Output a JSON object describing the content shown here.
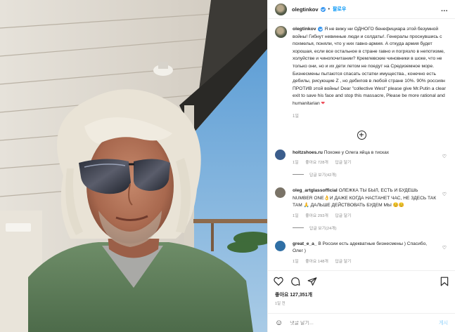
{
  "header": {
    "username": "olegtinkov",
    "separator": "•",
    "follow_label": "팔로우",
    "more_label": "..."
  },
  "caption": {
    "username": "olegtinkov",
    "text": "Я не вижу ни ОДНОГО бенефициара этой безумной войны! Гибнут невинные люди и солдаты!. Генералы проснувшись с похмелья, поняли, что у них гавно-армия. А откуда армия будет хорошая, если все остальное в стране гавно и погрязло в непотизме, холуйстве и чинопочитании? Кремлевские чиновники в шоке, что не только они, но и их дети летом не поедут на Средиземное море. Бизнесмены пытаются спасать остатки имущества., конечно есть дебилы, рисующие Z , но дебилов в любой стране 10%. 90% россиян ПРОТИВ этой войны! Dear \"collective West\" please give Mr.Putin a clear exit to save his face and stop this massacre, Please be more rational and humanitarian",
    "heart": "❤",
    "date": "1일"
  },
  "comments": [
    {
      "username": "holtzshoes.ru",
      "text": "Похоже у Олега яйца в тисках",
      "time": "1일",
      "likes": "좋아요 728개",
      "reply": "답글 달기",
      "replies": "답글 보기(42개)",
      "avatar_color": "#3b5d8c"
    },
    {
      "username": "oleg_artglassofficial",
      "text": "ОЛЕЖКА ТЫ БЫЛ, ЕСТЬ И БУДЕШЬ NUMBER ONE👌И ДАЖЕ КОГДА НАСТАНЕТ ЧАС, НЕ ЗДЕСЬ ТАК ТАМ 🙏 ДАЛЬШЕ ДЕЙСТВОВАТЬ БУДЕМ МЫ 😊😊",
      "time": "1일",
      "likes": "좋아요 293개",
      "reply": "답글 달기",
      "replies": "답글 보기(24개)",
      "avatar_color": "#7a7367"
    },
    {
      "username": "great_e_a_",
      "text": "В России есть адекватные бизнесмены ) Спасибо, Олег )",
      "time": "1일",
      "likes": "좋아요 148개",
      "reply": "답글 달기",
      "replies": "",
      "avatar_color": "#2f6fa5"
    }
  ],
  "actions": {
    "icons": [
      "heart-icon",
      "comment-icon",
      "share-icon",
      "bookmark-icon"
    ]
  },
  "likes_label": "좋아요 127,351개",
  "posted_ago": "1일 전",
  "comment_input": {
    "placeholder": "댓글 달기...",
    "post_label": "게시"
  },
  "colors": {
    "accent": "#0095f6",
    "verified": "#3897f0",
    "muted": "#8e8e8e",
    "like_heart": "#ed4956"
  }
}
